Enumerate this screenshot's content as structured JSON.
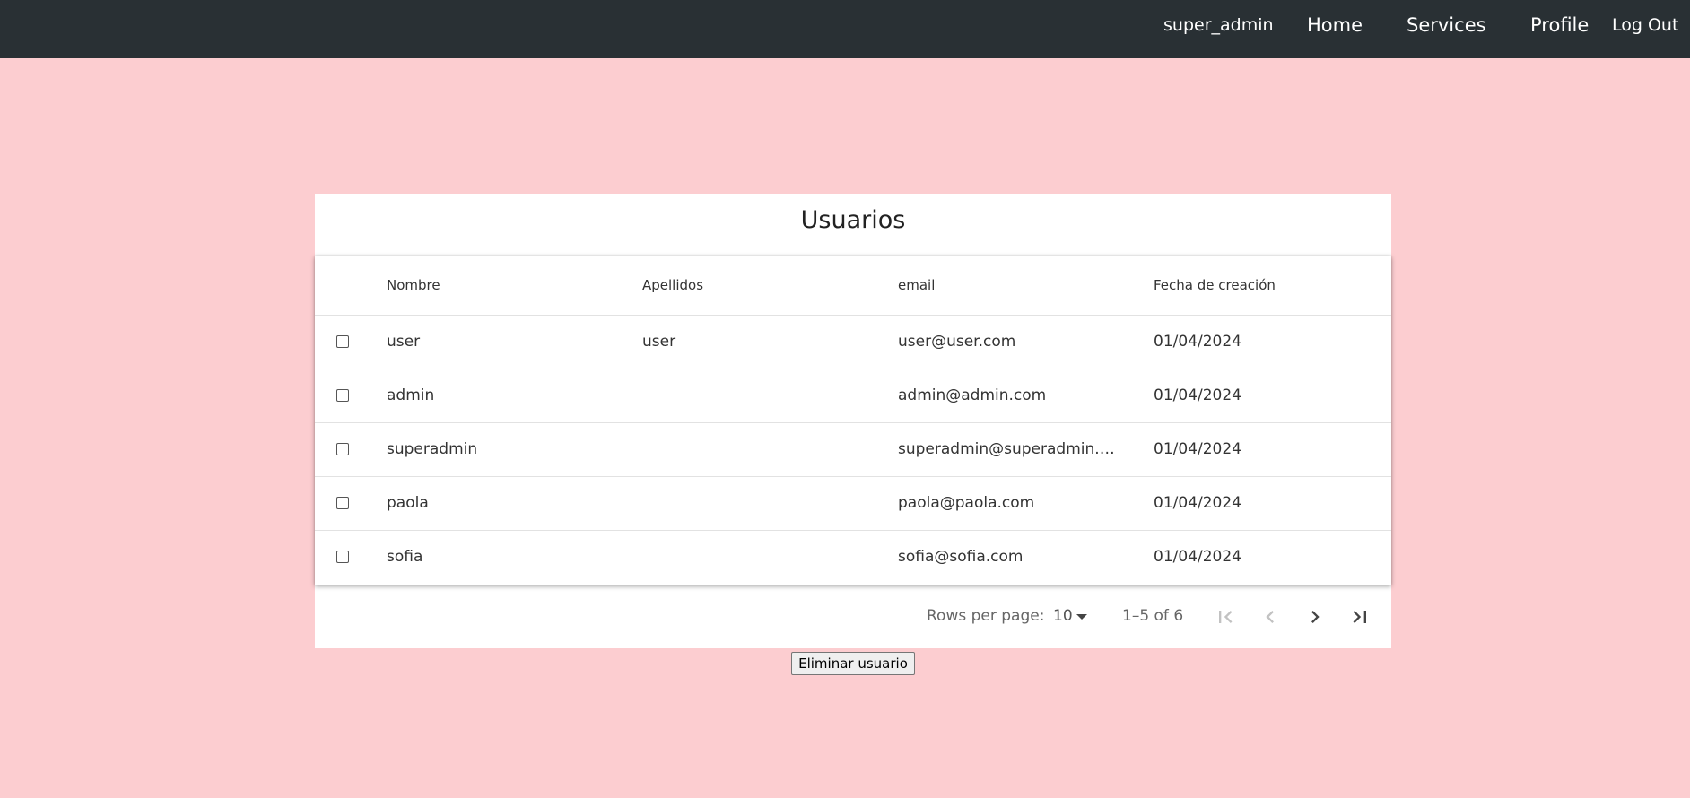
{
  "nav": {
    "username": "super_admin",
    "home_label": "Home",
    "services_label": "Services",
    "profile_label": "Profile",
    "logout_label": "Log Out"
  },
  "table": {
    "title": "Usuarios",
    "columns": [
      "Nombre",
      "Apellidos",
      "email",
      "Fecha de creación"
    ],
    "rows": [
      {
        "nombre": "user",
        "apellidos": "user",
        "email": "user@user.com",
        "fecha": "01/04/2024"
      },
      {
        "nombre": "admin",
        "apellidos": "",
        "email": "admin@admin.com",
        "fecha": "01/04/2024"
      },
      {
        "nombre": "superadmin",
        "apellidos": "",
        "email": "superadmin@superadmin.com",
        "fecha": "01/04/2024"
      },
      {
        "nombre": "paola",
        "apellidos": "",
        "email": "paola@paola.com",
        "fecha": "01/04/2024"
      },
      {
        "nombre": "sofia",
        "apellidos": "",
        "email": "sofia@sofia.com",
        "fecha": "01/04/2024"
      }
    ]
  },
  "pagination": {
    "rows_per_page_label": "Rows per page:",
    "rows_per_page_value": "10",
    "range_label": "1–5 of 6",
    "icons": [
      "first-page-icon",
      "prev-page-icon",
      "next-page-icon",
      "last-page-icon"
    ]
  },
  "actions": {
    "delete_label": "Eliminar usuario"
  },
  "colors": {
    "background": "#fccdd0",
    "navbar": "#293034"
  }
}
